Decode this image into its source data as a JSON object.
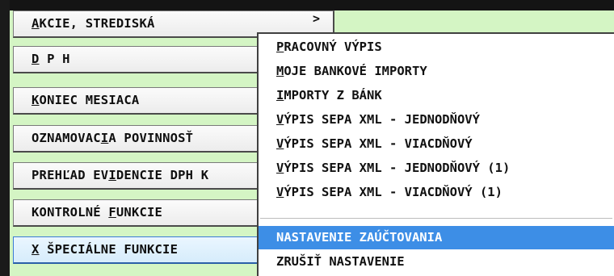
{
  "menu": {
    "items": [
      {
        "pre": "",
        "u": "A",
        "post": "KCIE, STREDISKÁ",
        "arrow": ">"
      },
      {
        "pre": "",
        "u": "D",
        "post": " P H"
      },
      {
        "pre": "",
        "u": "K",
        "post": "ONIEC MESIACA"
      },
      {
        "pre": "OZNAMOVAC",
        "u": "I",
        "post": "A POVINNOSŤ"
      },
      {
        "pre": "PREHĽAD EV",
        "u": "I",
        "post": "DENCIE DPH K"
      },
      {
        "pre": "KONTROLNÉ ",
        "u": "F",
        "post": "UNKCIE"
      },
      {
        "pre": "",
        "u": "X",
        "post": " ŠPECIÁLNE FUNKCIE"
      }
    ]
  },
  "popup": {
    "items": [
      {
        "pre": "",
        "u": "P",
        "post": "RACOVNÝ VÝPIS"
      },
      {
        "pre": "",
        "u": "M",
        "post": "OJE BANKOVÉ IMPORTY"
      },
      {
        "pre": "",
        "u": "I",
        "post": "MPORTY Z BÁNK"
      },
      {
        "pre": "",
        "u": "V",
        "post": "ÝPIS SEPA XML - JEDNODŇOVÝ"
      },
      {
        "pre": "",
        "u": "V",
        "post": "ÝPIS SEPA XML - VIACDŇOVÝ"
      },
      {
        "pre": "",
        "u": "V",
        "post": "ÝPIS SEPA XML - JEDNODŇOVÝ (1)"
      },
      {
        "pre": "",
        "u": "V",
        "post": "ÝPIS SEPA XML - VIACDŇOVÝ (1)"
      },
      {
        "pre": "",
        "u": "",
        "post": "NASTAVENIE ZAÚČTOVANIA"
      },
      {
        "pre": "",
        "u": "",
        "post": "ZRUŠIŤ NASTAVENIE"
      }
    ]
  }
}
